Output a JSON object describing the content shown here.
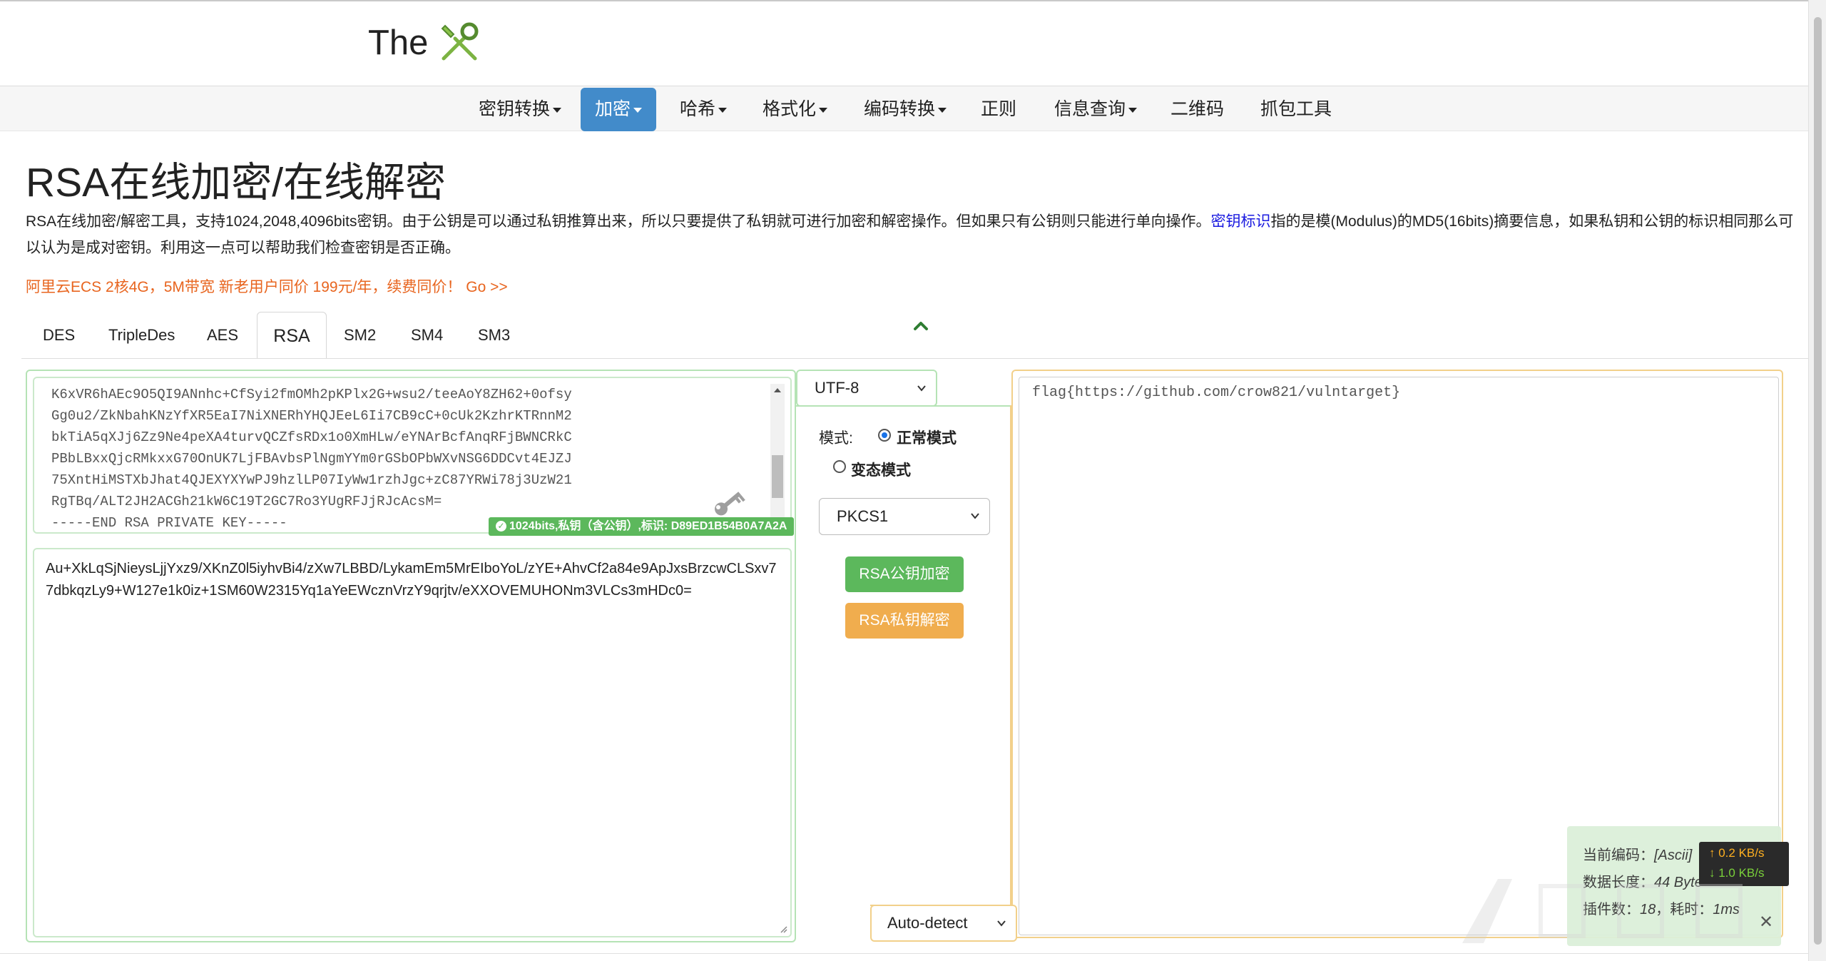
{
  "header": {
    "logo_text": "The"
  },
  "nav": {
    "items": [
      {
        "label": "密钥转换",
        "dropdown": true
      },
      {
        "label": "加密",
        "dropdown": true,
        "active": true
      },
      {
        "label": "哈希",
        "dropdown": true
      },
      {
        "label": "格式化",
        "dropdown": true
      },
      {
        "label": "编码转换",
        "dropdown": true
      },
      {
        "label": "正则",
        "dropdown": false
      },
      {
        "label": "信息查询",
        "dropdown": true
      },
      {
        "label": "二维码",
        "dropdown": false
      },
      {
        "label": "抓包工具",
        "dropdown": false
      }
    ]
  },
  "page": {
    "title": "RSA在线加密/在线解密",
    "desc_part1": "RSA在线加密/解密工具，支持1024,2048,4096bits密钥。由于公钥是可以通过私钥推算出来，所以只要提供了私钥就可进行加密和解密操作。但如果只有公钥则只能进行单向操作。",
    "desc_link": "密钥标识",
    "desc_part2": "指的是模(Modulus)的MD5(16bits)摘要信息，如果私钥和公钥的标识相同那么可以认为是成对密钥。利用这一点可以帮助我们检查密钥是否正确。",
    "promo": "阿里云ECS 2核4G，5M带宽 新老用户同价 199元/年，续费同价！ Go >>"
  },
  "tabs": [
    {
      "label": "DES"
    },
    {
      "label": "TripleDes"
    },
    {
      "label": "AES"
    },
    {
      "label": "RSA",
      "active": true
    },
    {
      "label": "SM2"
    },
    {
      "label": "SM4"
    },
    {
      "label": "SM3"
    }
  ],
  "key_area": {
    "text": "K6xVR6hAEc9O5QI9ANnhc+CfSyi2fmOMh2pKPlx2G+wsu2/teeAoY8ZH62+0ofsy\nGg0u2/ZkNbahKNzYfXR5EaI7NiXNERhYHQJEeL6Ii7CB9cC+0cUk2KzhrKTRnnM2\nbkTiA5qXJj6Zz9Ne4peXA4turvQCZfsRDx1o0XmHLw/eYNArBcfAnqRFjBWNCRkC\nPBbLBxxQjcRMkxxG70OnUK7LjFBAvbsPlNgmYYm0rGSbOPbWXvNSG6DDCvt4EJZJ\n75XntHiMSTXbJhat4QJEXYXYwPJ9hzlLP07IyWw1rzhJgc+zC87YRWi78j3UzW21\nRgTBq/ALT2JH2ACGh21kW6C19T2GC7Ro3YUgRFJjRJcAcsM=\n-----END RSA PRIVATE KEY-----",
    "badge": "1024bits,私钥（含公钥）,标识: D89ED1B54B0A7A2A"
  },
  "cipher_text": "Au+XkLqSjNieysLjjYxz9/XKnZ0l5iyhvBi4/zXw7LBBD/LykamEm5MrEIboYoL/zYE+AhvCf2a84e9ApJxsBrzcwCLSxv77dbkqzLy9+W127e1k0iz+1SM60W2315Yq1aYeEWcznVrzY9qrjtv/eXXOVEMUHONm3VLCs3mHDc0=",
  "controls": {
    "charset": "UTF-8",
    "mode_label": "模式:",
    "mode_normal": "正常模式",
    "mode_variant": "变态模式",
    "padding": "PKCS1",
    "encrypt_button": "RSA公钥加密",
    "decrypt_button": "RSA私钥解密",
    "auto_detect": "Auto-detect"
  },
  "plain_text": "flag{https://github.com/crow821/vulntarget}",
  "status": {
    "encoding_label": "当前编码：",
    "encoding_value": "[Ascii]",
    "length_label": "数据长度：",
    "length_value": "44 Byte",
    "plugins_label": "插件数：",
    "plugins_value": "18",
    "time_label": "，耗时：",
    "time_value": "1ms"
  },
  "net_speed": {
    "up": "↑ 0.2 KB/s",
    "down": "↓ 1.0 KB/s"
  },
  "colors": {
    "nav_active": "#428bca",
    "btn_green": "#5cb85c",
    "btn_orange": "#f0ad4e",
    "promo": "#e8651f",
    "link": "#1a1ae0"
  }
}
